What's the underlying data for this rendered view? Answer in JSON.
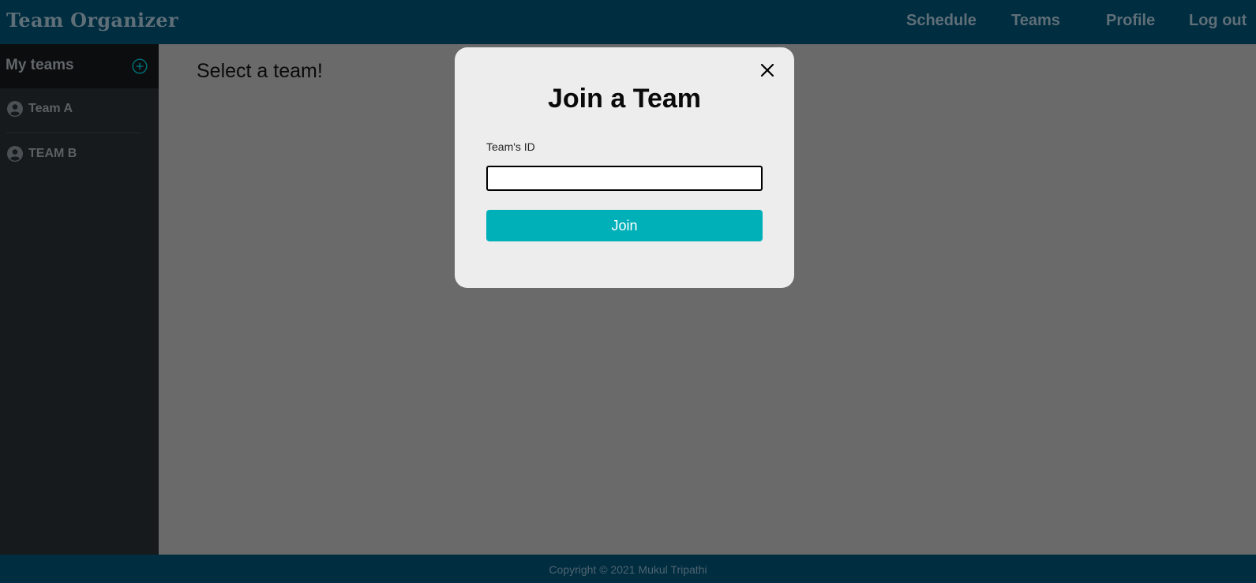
{
  "navbar": {
    "brand": "Team Organizer",
    "links": [
      {
        "label": "Schedule"
      },
      {
        "label": "Teams"
      },
      {
        "label": "Profile"
      },
      {
        "label": "Log out"
      }
    ]
  },
  "sidebar": {
    "title": "My teams",
    "add_icon": "plus-circle-icon",
    "teams": [
      {
        "label": "Team A",
        "icon": "user-circle-icon"
      },
      {
        "label": "TEAM B",
        "icon": "user-circle-icon"
      }
    ]
  },
  "main": {
    "title": "Select a team!"
  },
  "modal": {
    "title": "Join a Team",
    "field_label": "Team's ID",
    "input_value": "",
    "button_label": "Join",
    "close_icon": "close-icon"
  },
  "footer": {
    "copyright": "Copyright © 2021 Mukul Tripathi"
  },
  "colors": {
    "navbar_bg": "#002d40",
    "sidebar_bg": "#161a1d",
    "accent": "#00b0b9",
    "overlay": "#6a6a6a",
    "modal_bg": "#ededed"
  }
}
